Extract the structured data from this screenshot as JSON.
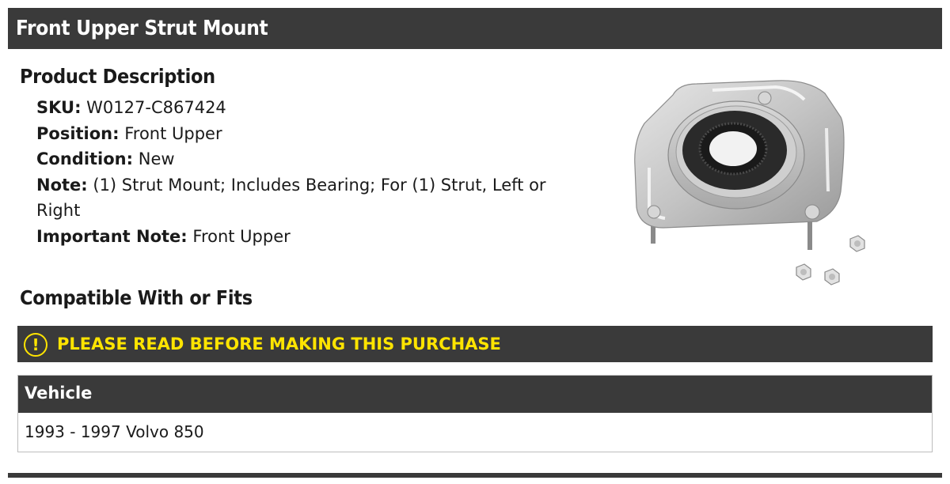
{
  "header": {
    "title": "Front Upper Strut Mount"
  },
  "product_description": {
    "heading": "Product Description",
    "fields": [
      {
        "label": "SKU:",
        "value": "W0127-C867424"
      },
      {
        "label": "Position:",
        "value": "Front Upper"
      },
      {
        "label": "Condition:",
        "value": "New"
      },
      {
        "label": "Note:",
        "value": "(1) Strut Mount; Includes Bearing; For (1) Strut, Left or Right"
      },
      {
        "label": "Important Note:",
        "value": "Front Upper"
      }
    ]
  },
  "product_image": {
    "icon": "strut-mount-product-image"
  },
  "compatibility": {
    "heading": "Compatible With or Fits",
    "warning": {
      "icon": "exclamation-circle-icon",
      "text": "PLEASE READ BEFORE MAKING THIS PURCHASE",
      "color": "#ffe400"
    },
    "table": {
      "header": "Vehicle",
      "rows": [
        "1993 - 1997 Volvo 850"
      ]
    }
  },
  "colors": {
    "bar": "#3a3a3a",
    "warning_text": "#ffe400"
  }
}
